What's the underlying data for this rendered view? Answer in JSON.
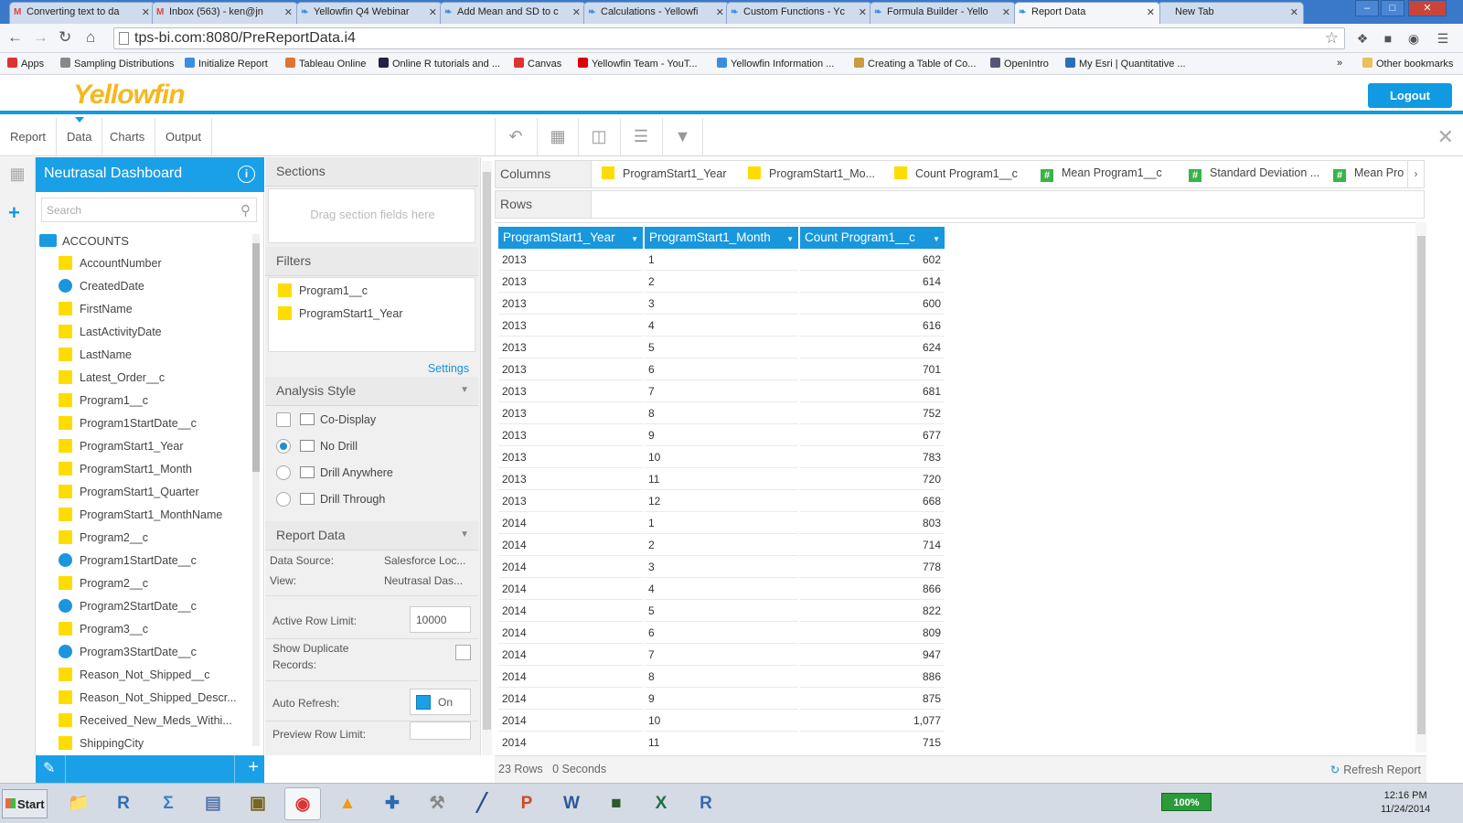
{
  "browser": {
    "tabs": [
      {
        "title": "Converting text to da",
        "icon": "gmail-icon"
      },
      {
        "title": "Inbox (563) - ken@jn",
        "icon": "gmail-icon"
      },
      {
        "title": "Yellowfin Q4 Webinar",
        "icon": "yellowfin-icon"
      },
      {
        "title": "Add Mean and SD to c",
        "icon": "yellowfin-icon"
      },
      {
        "title": "Calculations - Yellowfi",
        "icon": "yellowfin-icon"
      },
      {
        "title": "Custom Functions - Yc",
        "icon": "yellowfin-icon"
      },
      {
        "title": "Formula Builder - Yello",
        "icon": "yellowfin-icon"
      },
      {
        "title": "Report Data",
        "icon": "yellowfin-icon"
      },
      {
        "title": "New Tab",
        "icon": ""
      }
    ],
    "url": "tps-bi.com:8080/PreReportData.i4",
    "bookmarks": [
      {
        "label": "Apps",
        "color": "#d33"
      },
      {
        "label": "Sampling Distributions",
        "color": "#888"
      },
      {
        "label": "Initialize Report",
        "color": "#3a8ee0"
      },
      {
        "label": "Tableau Online",
        "color": "#e0752f"
      },
      {
        "label": "Online R tutorials and ...",
        "color": "#224"
      },
      {
        "label": "Canvas",
        "color": "#d33"
      },
      {
        "label": "Yellowfin Team - YouT...",
        "color": "#d00"
      },
      {
        "label": "Yellowfin Information ...",
        "color": "#3a8ee0"
      },
      {
        "label": "Creating a Table of Co...",
        "color": "#c94"
      },
      {
        "label": "OpenIntro",
        "color": "#557"
      },
      {
        "label": "My Esri | Quantitative ...",
        "color": "#2b6fb8"
      }
    ],
    "bookmarks_more": "»",
    "other_bookmarks": "Other bookmarks"
  },
  "app": {
    "logo": "Yellowfin",
    "logout_label": "Logout",
    "nav_tabs": [
      "Report",
      "Data",
      "Charts",
      "Output"
    ],
    "active_nav": "Data"
  },
  "field_panel": {
    "title": "Neutrasal Dashboard",
    "search_placeholder": "Search",
    "group": "ACCOUNTS",
    "fields": [
      {
        "name": "AccountNumber",
        "type": "dim"
      },
      {
        "name": "CreatedDate",
        "type": "date"
      },
      {
        "name": "FirstName",
        "type": "dim"
      },
      {
        "name": "LastActivityDate",
        "type": "dim"
      },
      {
        "name": "LastName",
        "type": "dim"
      },
      {
        "name": "Latest_Order__c",
        "type": "dim"
      },
      {
        "name": "Program1__c",
        "type": "dim"
      },
      {
        "name": "Program1StartDate__c",
        "type": "dim"
      },
      {
        "name": "ProgramStart1_Year",
        "type": "dim"
      },
      {
        "name": "ProgramStart1_Month",
        "type": "dim"
      },
      {
        "name": "ProgramStart1_Quarter",
        "type": "dim"
      },
      {
        "name": "ProgramStart1_MonthName",
        "type": "dim"
      },
      {
        "name": "Program2__c",
        "type": "dim"
      },
      {
        "name": "Program1StartDate__c",
        "type": "date"
      },
      {
        "name": "Program2__c",
        "type": "dim"
      },
      {
        "name": "Program2StartDate__c",
        "type": "date"
      },
      {
        "name": "Program3__c",
        "type": "dim"
      },
      {
        "name": "Program3StartDate__c",
        "type": "date"
      },
      {
        "name": "Reason_Not_Shipped__c",
        "type": "dim"
      },
      {
        "name": "Reason_Not_Shipped_Descr...",
        "type": "dim"
      },
      {
        "name": "Received_New_Meds_Withi...",
        "type": "dim"
      },
      {
        "name": "ShippingCity",
        "type": "dim"
      }
    ]
  },
  "sections": {
    "title": "Sections",
    "placeholder": "Drag section fields here"
  },
  "filters": {
    "title": "Filters",
    "items": [
      "Program1__c",
      "ProgramStart1_Year"
    ],
    "settings_label": "Settings"
  },
  "analysis_style": {
    "title": "Analysis Style",
    "options": [
      {
        "label": "Co-Display",
        "control": "checkbox",
        "checked": false
      },
      {
        "label": "No Drill",
        "control": "radio",
        "checked": true
      },
      {
        "label": "Drill Anywhere",
        "control": "radio",
        "checked": false
      },
      {
        "label": "Drill Through",
        "control": "radio",
        "checked": false
      }
    ]
  },
  "report_data": {
    "title": "Report Data",
    "data_source_label": "Data Source:",
    "data_source_value": "Salesforce Loc...",
    "view_label": "View:",
    "view_value": "Neutrasal Das...",
    "active_row_limit_label": "Active Row Limit:",
    "active_row_limit_value": "10000",
    "show_duplicate_label_1": "Show Duplicate",
    "show_duplicate_label_2": "Records:",
    "auto_refresh_label": "Auto Refresh:",
    "auto_refresh_value": "On",
    "preview_row_limit_label": "Preview Row Limit:"
  },
  "columns_bar": {
    "label": "Columns",
    "chips": [
      {
        "label": "ProgramStart1_Year",
        "kind": "y"
      },
      {
        "label": "ProgramStart1_Mo...",
        "kind": "y"
      },
      {
        "label": "Count Program1__c",
        "kind": "y"
      },
      {
        "label": "Mean Program1__c",
        "kind": "g"
      },
      {
        "label": "Standard Deviation ...",
        "kind": "g"
      },
      {
        "label": "Mean Pro",
        "kind": "g"
      }
    ]
  },
  "rows_bar": {
    "label": "Rows"
  },
  "table": {
    "headers": [
      "ProgramStart1_Year",
      "ProgramStart1_Month",
      "Count Program1__c"
    ],
    "rows": [
      [
        "2013",
        "1",
        "602"
      ],
      [
        "2013",
        "2",
        "614"
      ],
      [
        "2013",
        "3",
        "600"
      ],
      [
        "2013",
        "4",
        "616"
      ],
      [
        "2013",
        "5",
        "624"
      ],
      [
        "2013",
        "6",
        "701"
      ],
      [
        "2013",
        "7",
        "681"
      ],
      [
        "2013",
        "8",
        "752"
      ],
      [
        "2013",
        "9",
        "677"
      ],
      [
        "2013",
        "10",
        "783"
      ],
      [
        "2013",
        "11",
        "720"
      ],
      [
        "2013",
        "12",
        "668"
      ],
      [
        "2014",
        "1",
        "803"
      ],
      [
        "2014",
        "2",
        "714"
      ],
      [
        "2014",
        "3",
        "778"
      ],
      [
        "2014",
        "4",
        "866"
      ],
      [
        "2014",
        "5",
        "822"
      ],
      [
        "2014",
        "6",
        "809"
      ],
      [
        "2014",
        "7",
        "947"
      ],
      [
        "2014",
        "8",
        "886"
      ],
      [
        "2014",
        "9",
        "875"
      ],
      [
        "2014",
        "10",
        "1,077"
      ],
      [
        "2014",
        "11",
        "715"
      ]
    ]
  },
  "status": {
    "rows": "23 Rows",
    "time": "0 Seconds",
    "refresh_label": "Refresh Report"
  },
  "taskbar": {
    "start_label": "Start",
    "apps": [
      {
        "name": "explorer",
        "glyph": "📁",
        "color": "#e8b94a"
      },
      {
        "name": "r-console",
        "glyph": "R",
        "color": "#2b6fb8"
      },
      {
        "name": "sigma",
        "glyph": "Σ",
        "color": "#3c7ec7"
      },
      {
        "name": "network",
        "glyph": "▤",
        "color": "#5577aa"
      },
      {
        "name": "lock",
        "glyph": "▣",
        "color": "#776622"
      },
      {
        "name": "chrome",
        "glyph": "◉",
        "color": "#d33"
      },
      {
        "name": "vlc",
        "glyph": "▲",
        "color": "#f29a12"
      },
      {
        "name": "plot",
        "glyph": "✚",
        "color": "#2a6ab0"
      },
      {
        "name": "tool",
        "glyph": "⚒",
        "color": "#888"
      },
      {
        "name": "sketch",
        "glyph": "╱",
        "color": "#2a4d88"
      },
      {
        "name": "powerpoint",
        "glyph": "P",
        "color": "#d24726"
      },
      {
        "name": "word",
        "glyph": "W",
        "color": "#2b579a"
      },
      {
        "name": "terminal",
        "glyph": "■",
        "color": "#2d5a2d"
      },
      {
        "name": "excel",
        "glyph": "X",
        "color": "#1f7145"
      },
      {
        "name": "rstudio",
        "glyph": "R",
        "color": "#3568b5"
      }
    ],
    "battery": "100%",
    "time": "12:16 PM",
    "date": "11/24/2014"
  }
}
